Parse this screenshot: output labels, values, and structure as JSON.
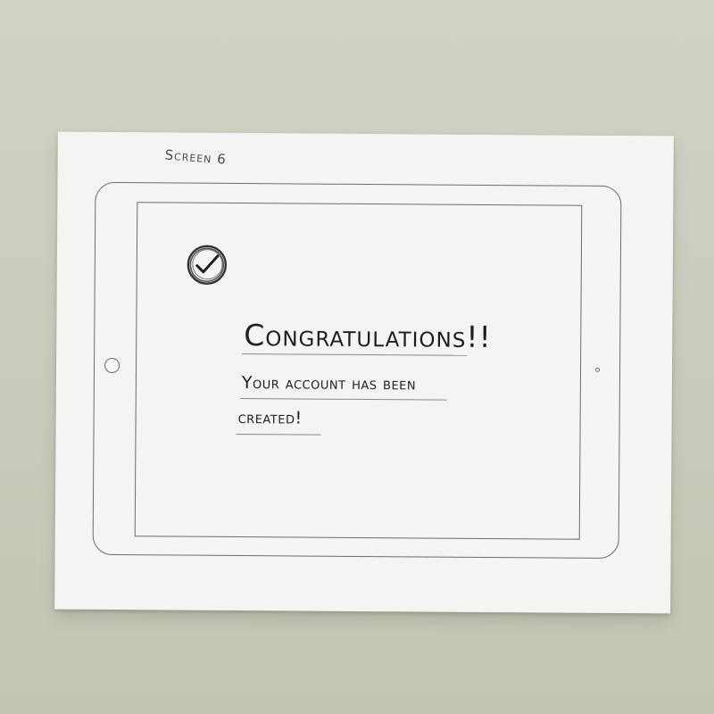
{
  "sketch": {
    "screen_label": "Screen 6"
  },
  "confirmation": {
    "icon": "check-circle-icon",
    "headline": "Congratulations!!",
    "message_line1": "Your account has been",
    "message_line2": "created!"
  },
  "colors": {
    "pencil": "#1e1e1e",
    "paper": "#f4f4f2",
    "background": "#cbcbbd"
  }
}
